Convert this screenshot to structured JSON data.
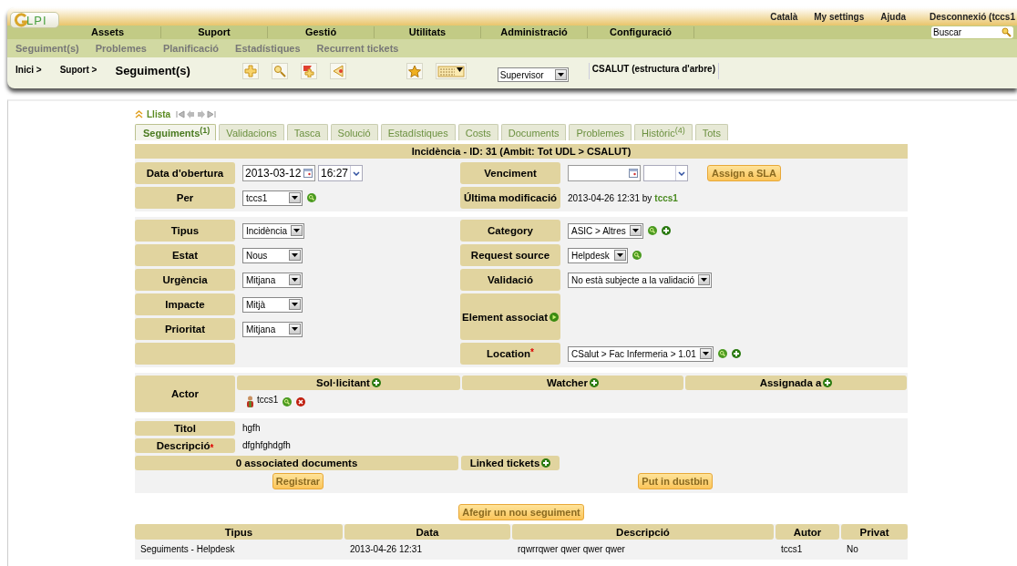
{
  "header": {
    "logo": "LPI",
    "top_links": [
      "Català",
      "My settings",
      "Ajuda",
      "Desconnexió (tccs1"
    ],
    "search": {
      "placeholder": "Buscar"
    },
    "main_menu": [
      "Assets",
      "Suport",
      "Gestió",
      "Utilitats",
      "Administració",
      "Configuració"
    ],
    "sub_menu": [
      "Seguiment(s)",
      "Problemes",
      "Planificació",
      "Estadístiques",
      "Recurrent tickets"
    ],
    "breadcrumb": [
      "Inici >",
      "Suport >"
    ],
    "page_title": "Seguiment(s)",
    "profile": "Supervisor",
    "entity": "CSALUT (estructura d'arbre)"
  },
  "nav": {
    "label": "Llista"
  },
  "tabs": [
    {
      "label": "Seguiments",
      "count": "(1)",
      "selected": true
    },
    {
      "label": "Validacions",
      "selected": false
    },
    {
      "label": "Tasca",
      "selected": false
    },
    {
      "label": "Solució",
      "selected": false
    },
    {
      "label": "Estadístiques",
      "selected": false
    },
    {
      "label": "Costs",
      "selected": false
    },
    {
      "label": "Documents",
      "selected": false
    },
    {
      "label": "Problemes",
      "selected": false
    },
    {
      "label": "Històric",
      "count": "(4)",
      "selected": false
    },
    {
      "label": "Tots",
      "selected": false
    }
  ],
  "ticket_title": "Incidència - ID: 31 (Ambit: Tot UDL > CSALUT)",
  "sections": [
    {
      "left": [
        {
          "label": "Data d'obertura",
          "kind": "datetime",
          "date": "2013-03-12",
          "time": "16:27"
        },
        {
          "label": "Per",
          "kind": "select",
          "value": "tccs1",
          "edit_button": true
        }
      ],
      "right": [
        {
          "label": "Venciment",
          "kind": "datetime",
          "button": "Assign a SLA"
        },
        {
          "label": "Última modificació",
          "kind": "text",
          "value": "2013-04-26 12:31 by",
          "user": "tccs1"
        }
      ]
    },
    {
      "left": [
        {
          "label": "Tipus",
          "kind": "select",
          "value": "Incidència"
        },
        {
          "label": "Estat",
          "kind": "select",
          "value": "Nous"
        },
        {
          "label": "Urgència",
          "kind": "select",
          "value": "Mitjana"
        },
        {
          "label": "Impacte",
          "kind": "select",
          "value": "Mitjà"
        },
        {
          "label": "Prioritat",
          "kind": "select",
          "value": "Mitjana"
        },
        {
          "kind": "empty"
        }
      ],
      "right": [
        {
          "label": "Category",
          "kind": "select",
          "value": "ASIC > Altres",
          "edit_button": true,
          "add_button": true
        },
        {
          "label": "Request source",
          "kind": "select",
          "value": "Helpdesk",
          "edit_button": true
        },
        {
          "label": "Validació",
          "kind": "select",
          "value": "No està subjecte a la validació"
        },
        {
          "label": "Element associat",
          "kind": "items"
        },
        {
          "label": "Location",
          "required": "*",
          "kind": "select",
          "value": "CSalut > Fac Infermeria > 1.01",
          "edit_button": true,
          "add_button": true
        }
      ]
    }
  ],
  "actors": {
    "label": "Actor",
    "columns": [
      {
        "label": "Sol·licitant",
        "users": [
          "tccs1"
        ]
      },
      {
        "label": "Watcher"
      },
      {
        "label": "Assignada a"
      }
    ]
  },
  "details": [
    {
      "label": "Titol",
      "value": "hgfh"
    },
    {
      "label": "Descripció",
      "required": "*",
      "value": "dfghfghdgfh"
    }
  ],
  "documents": "0 associated documents",
  "linked_tickets": "Linked tickets",
  "buttons": [
    "Registrar",
    "Put in dustbin"
  ],
  "add_followup": "Afegir un nou seguiment",
  "followups": {
    "columns": [
      "Tipus",
      "Data",
      "Descripció",
      "Autor",
      "Privat"
    ],
    "rows": [
      [
        "Seguiments - Helpdesk",
        "2013-04-26 12:31",
        "rqwrrqwer qwer qwer qwer",
        "tccs1",
        "No"
      ]
    ]
  }
}
